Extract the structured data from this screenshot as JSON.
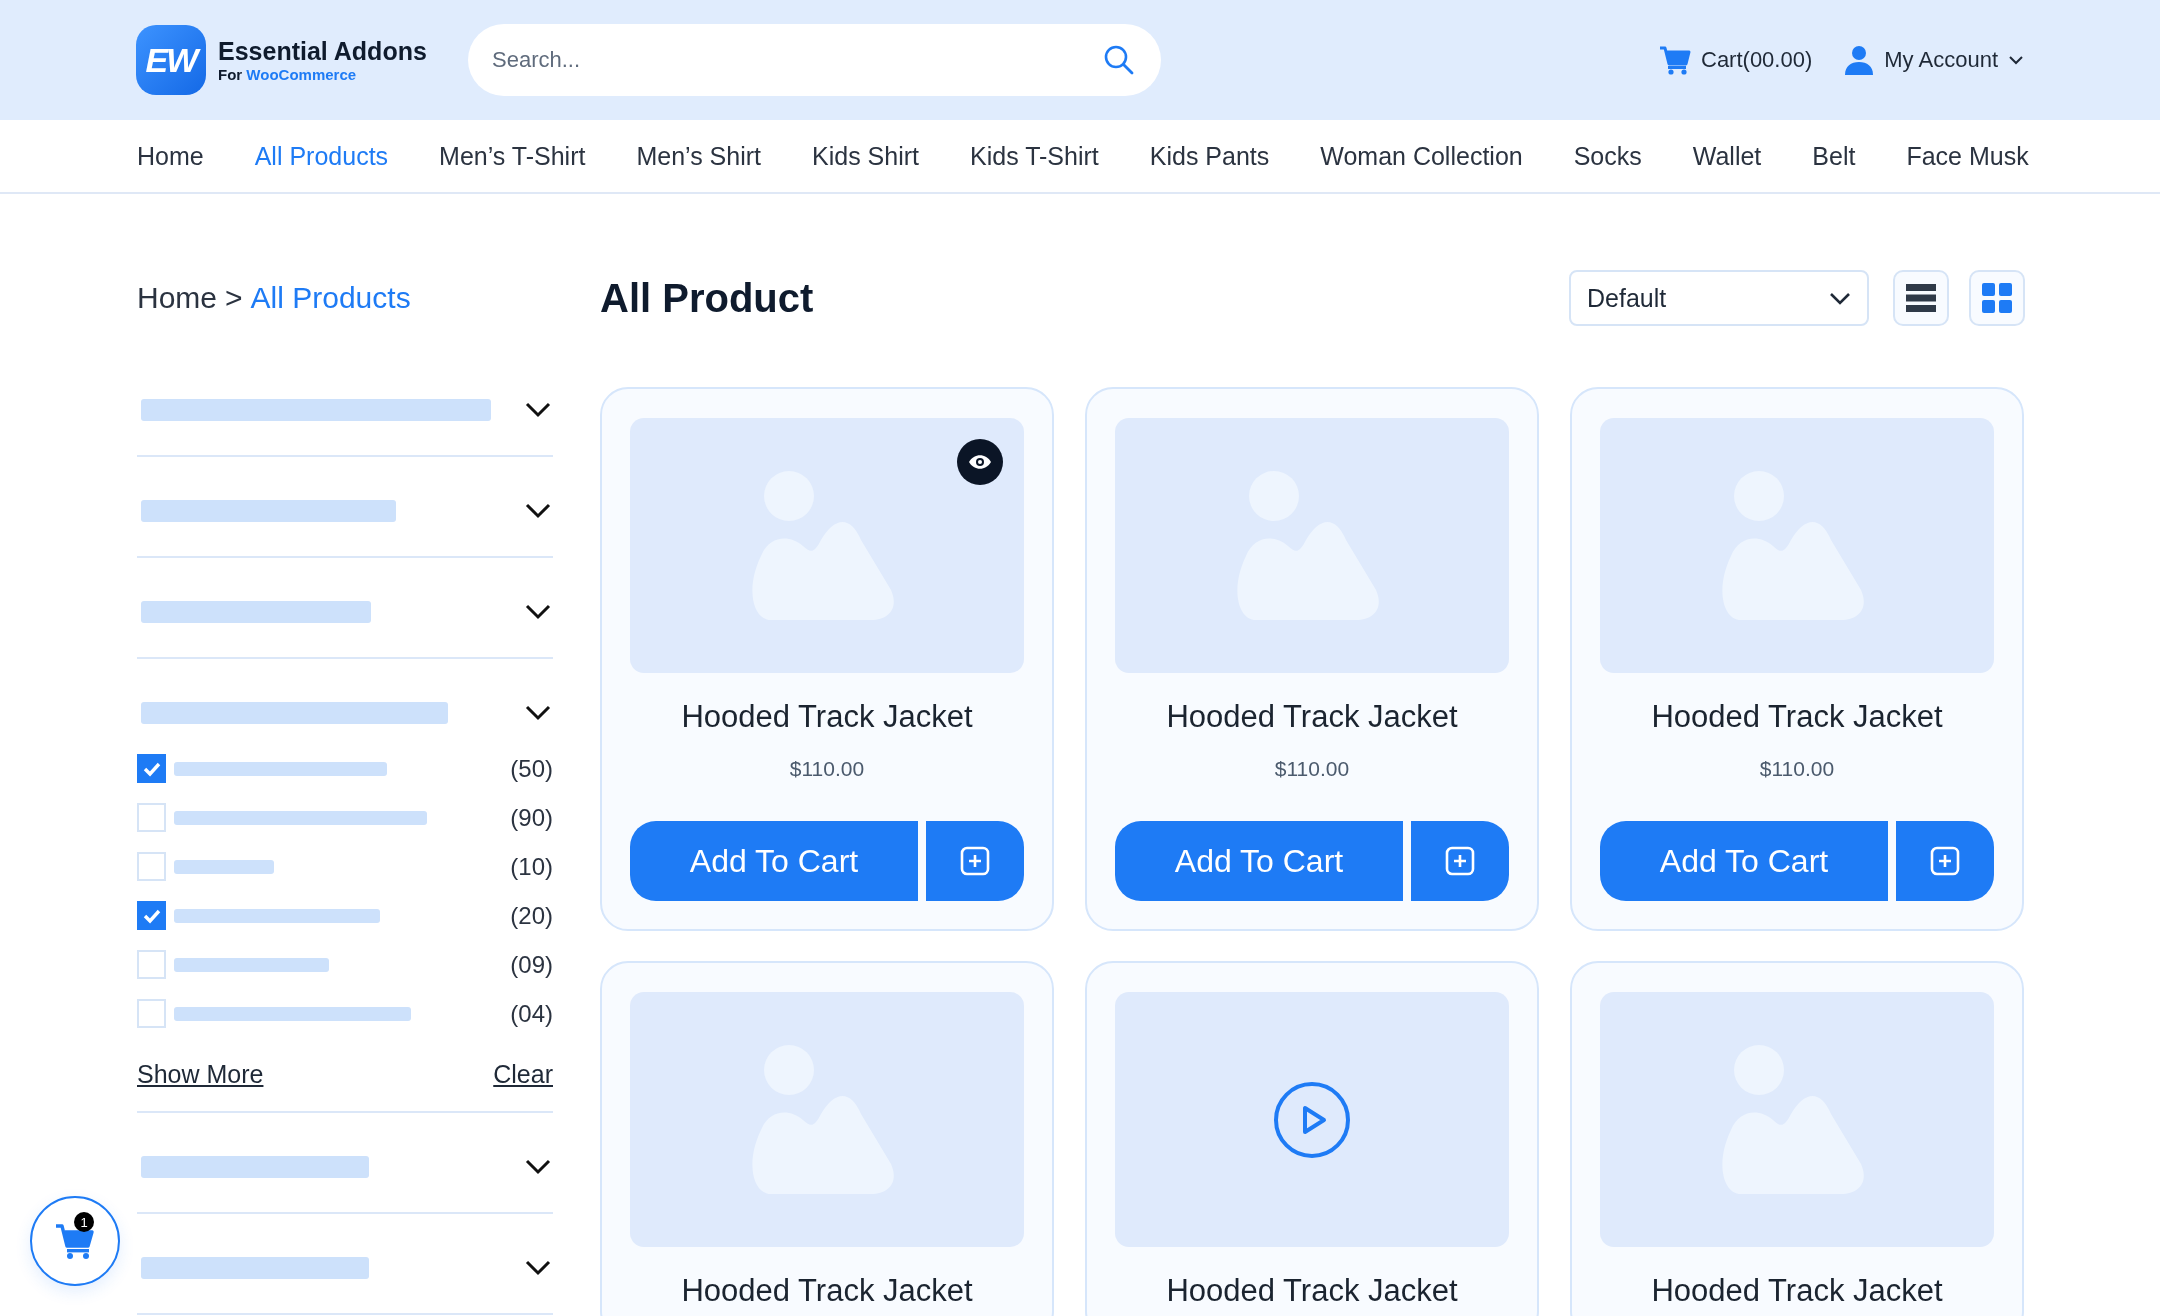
{
  "header": {
    "logo": {
      "mark": "EW",
      "name": "Essential Addons",
      "tagline_prefix": "For",
      "tagline_brand": "WooCommerce"
    },
    "search": {
      "placeholder": "Search..."
    },
    "cart": {
      "label": "Cart(00.00)"
    },
    "account": {
      "label": "My Account"
    }
  },
  "nav": [
    {
      "label": "Home",
      "selected": false
    },
    {
      "label": "All Products",
      "selected": true
    },
    {
      "label": "Men’s T-Shirt",
      "selected": false
    },
    {
      "label": "Men’s Shirt",
      "selected": false
    },
    {
      "label": "Kids Shirt",
      "selected": false
    },
    {
      "label": "Kids T-Shirt",
      "selected": false
    },
    {
      "label": "Kids Pants",
      "selected": false
    },
    {
      "label": "Woman Collection",
      "selected": false
    },
    {
      "label": "Socks",
      "selected": false
    },
    {
      "label": "Wallet",
      "selected": false
    },
    {
      "label": "Belt",
      "selected": false
    },
    {
      "label": "Face Musk",
      "selected": false
    }
  ],
  "breadcrumb": {
    "home": "Home",
    "separator": ">",
    "current": "All Products"
  },
  "filter_group": {
    "options": [
      {
        "checked": true,
        "count": "(50)"
      },
      {
        "checked": false,
        "count": "(90)"
      },
      {
        "checked": false,
        "count": "(10)"
      },
      {
        "checked": true,
        "count": "(20)"
      },
      {
        "checked": false,
        "count": "(09)"
      },
      {
        "checked": false,
        "count": "(04)"
      }
    ],
    "show_more": "Show More",
    "clear": "Clear"
  },
  "page_title": "All Product",
  "sort": {
    "value": "Default"
  },
  "views": [
    {
      "kind": "list",
      "selected": false
    },
    {
      "kind": "grid",
      "selected": true
    }
  ],
  "products": [
    {
      "kind": "image",
      "quick_view": true,
      "title": "Hooded Track Jacket",
      "price": "$110.00",
      "button": "Add To Cart"
    },
    {
      "kind": "image",
      "quick_view": false,
      "title": "Hooded Track Jacket",
      "price": "$110.00",
      "button": "Add To Cart"
    },
    {
      "kind": "image",
      "quick_view": false,
      "title": "Hooded Track Jacket",
      "price": "$110.00",
      "button": "Add To Cart"
    },
    {
      "kind": "image",
      "quick_view": false,
      "title": "Hooded Track Jacket"
    },
    {
      "kind": "video",
      "quick_view": false,
      "title": "Hooded Track Jacket"
    },
    {
      "kind": "image",
      "quick_view": false,
      "title": "Hooded Track Jacket"
    }
  ],
  "floating_cart": {
    "count": "1"
  }
}
